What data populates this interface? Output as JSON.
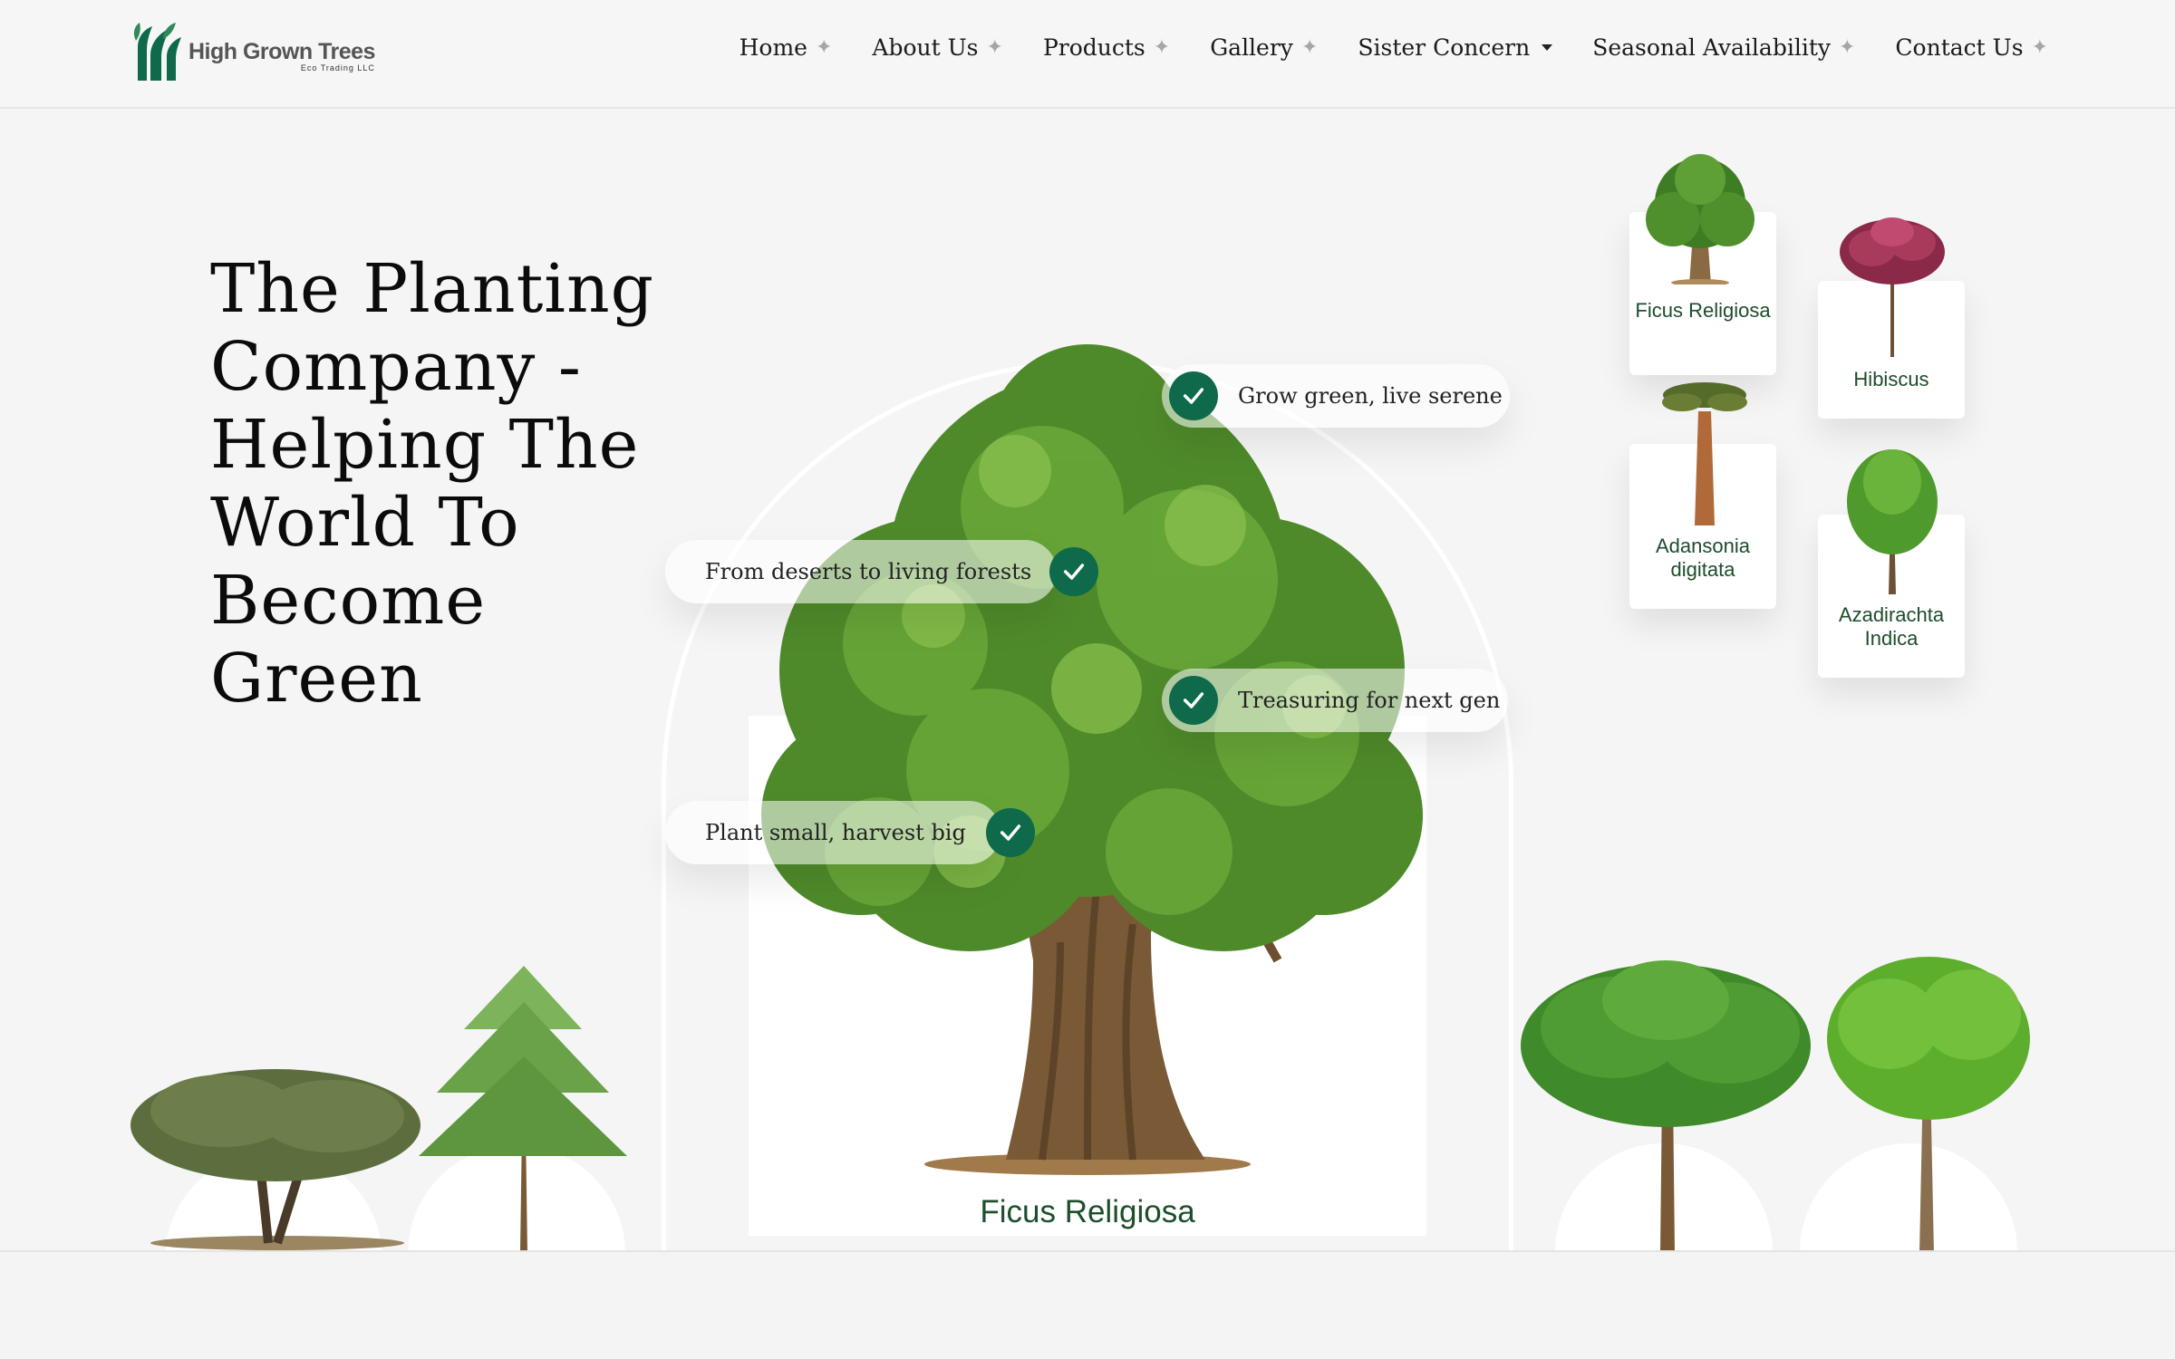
{
  "brand": {
    "name": "High Grown Trees",
    "tagline": "Eco Trading LLC",
    "color": "#0e6a4a"
  },
  "nav": {
    "items": [
      {
        "label": "Home",
        "icon": "plus-sparkle-icon"
      },
      {
        "label": "About Us",
        "icon": "plus-sparkle-icon"
      },
      {
        "label": "Products",
        "icon": "plus-sparkle-icon"
      },
      {
        "label": "Gallery",
        "icon": "plus-sparkle-icon"
      },
      {
        "label": "Sister Concern",
        "icon": "caret-down-icon"
      },
      {
        "label": "Seasonal Availability",
        "icon": "plus-sparkle-icon"
      },
      {
        "label": "Contact Us",
        "icon": "plus-sparkle-icon"
      }
    ]
  },
  "hero": {
    "title": "The Planting Company - Helping The World To Become Green",
    "featured_tree": "Ficus Religiosa",
    "features": [
      "Grow green, live serene",
      "From deserts to living forests",
      "Treasuring for next gen",
      "Plant small, harvest big"
    ]
  },
  "cards": [
    {
      "label": "Ficus Religiosa"
    },
    {
      "label": "Hibiscus"
    },
    {
      "label": "Adansonia digitata"
    },
    {
      "label": "Azadirachta Indica"
    }
  ],
  "colors": {
    "accent": "#0e6a4a",
    "label_green": "#1c4f2a",
    "background": "#f5f5f5"
  }
}
